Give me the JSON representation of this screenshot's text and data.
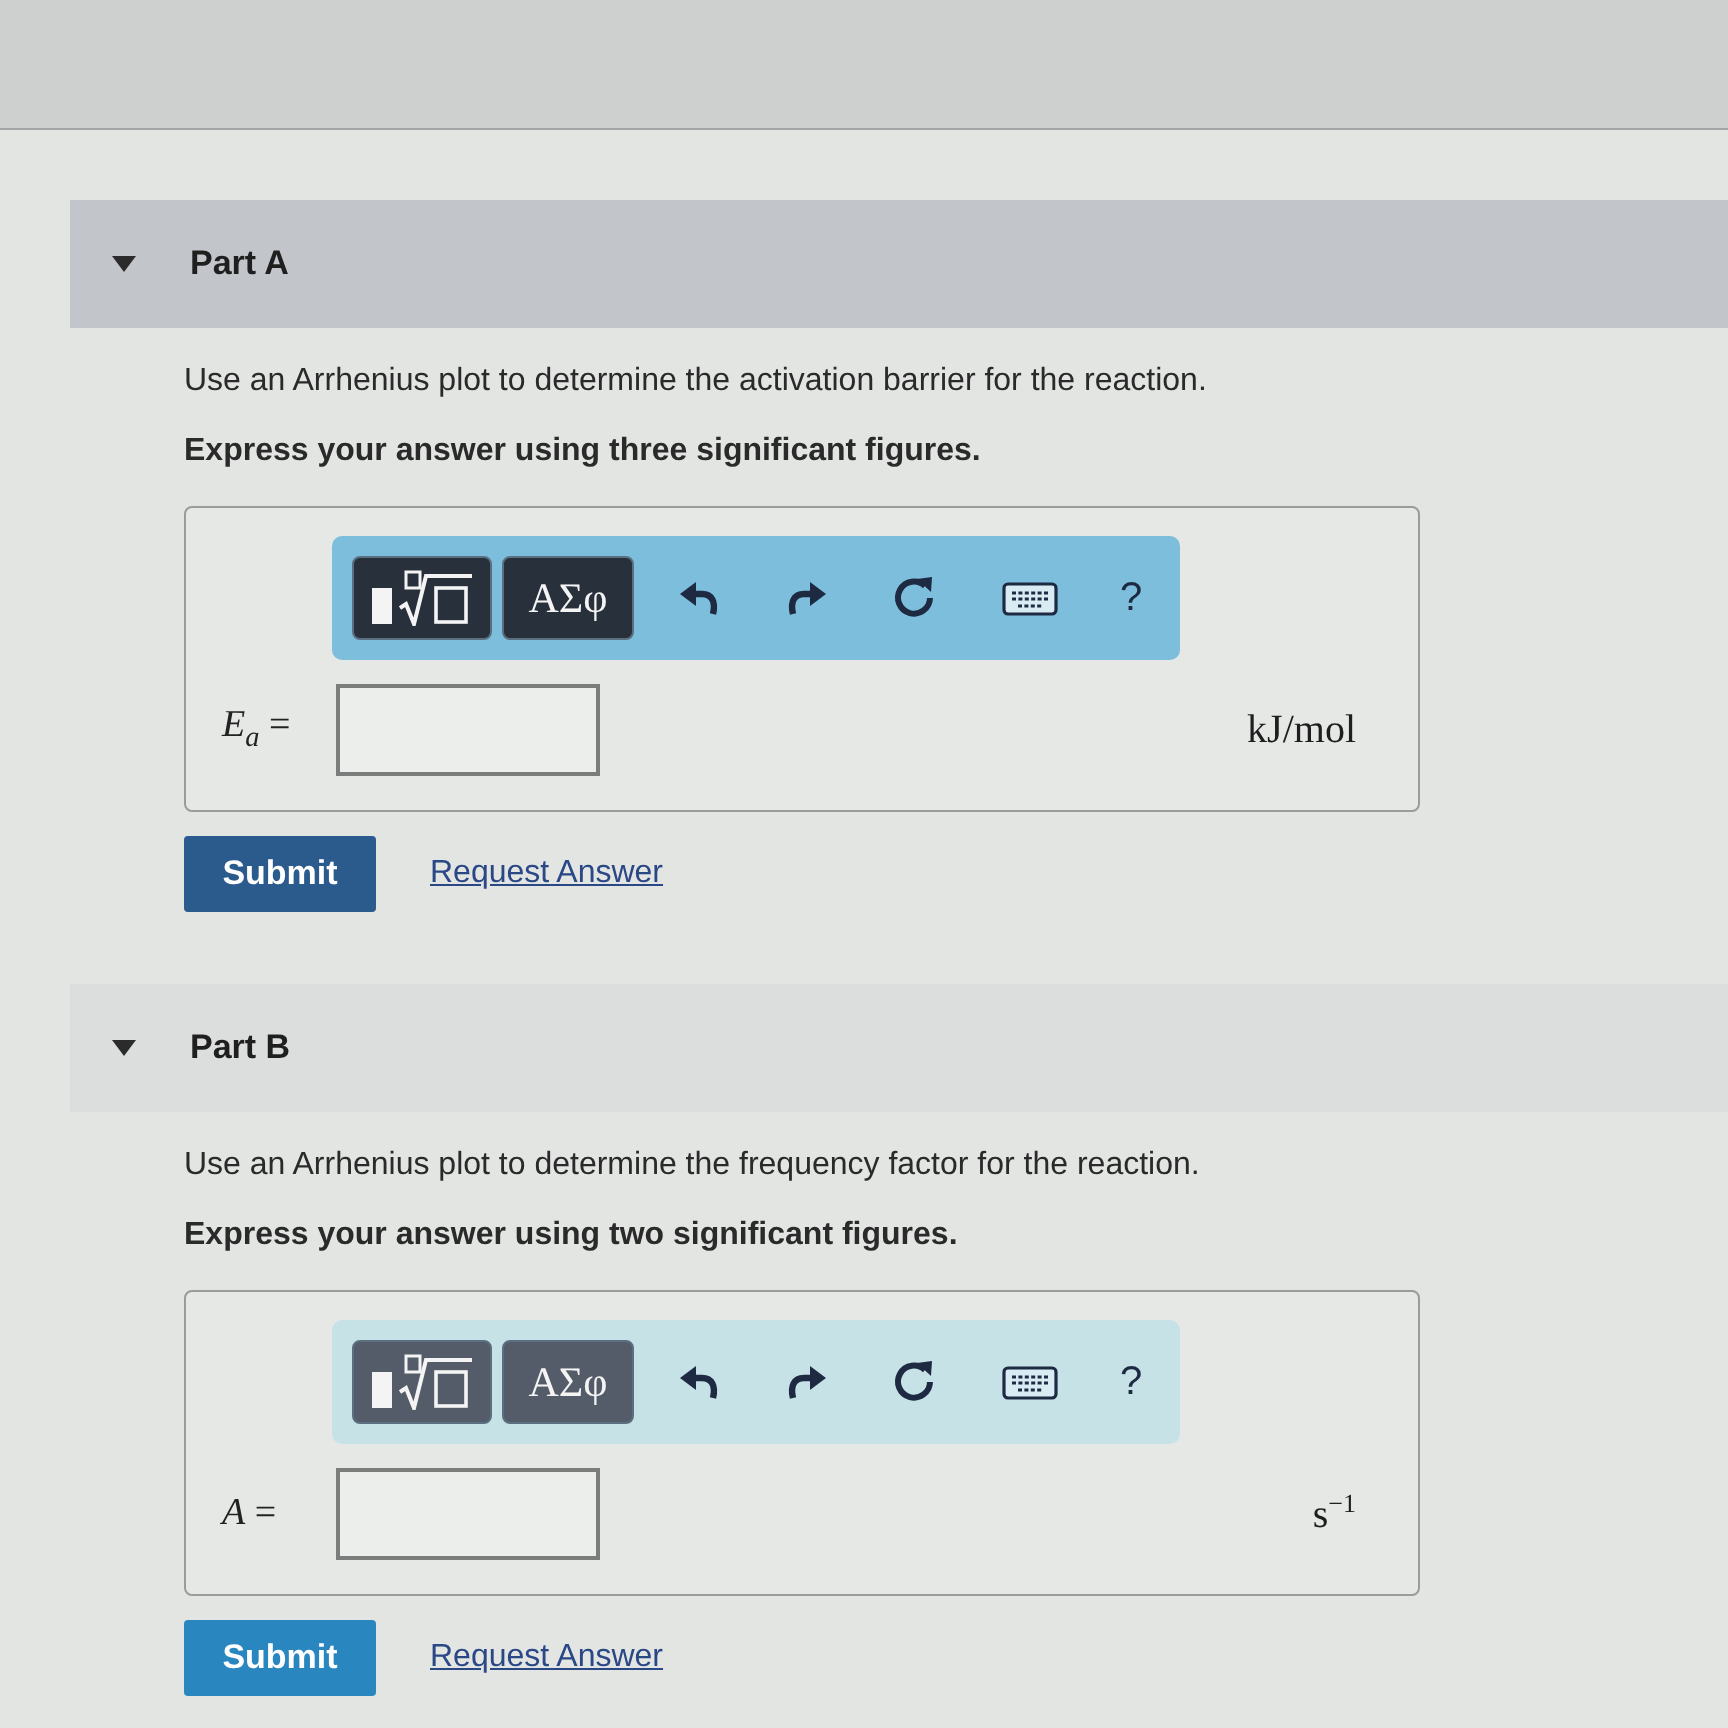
{
  "parts": [
    {
      "title": "Part A",
      "expanded": true,
      "active": true,
      "prompt": "Use an Arrhenius plot to determine the activation barrier for the reaction.",
      "instruction": "Express your answer using three significant figures.",
      "toolbar": {
        "symbols_label": "ΑΣφ",
        "help_label": "?"
      },
      "answer": {
        "label": "*E*$_{a}$ =",
        "unit": "kJ/mol"
      },
      "submit_label": "Submit",
      "request_label": "Request Answer"
    },
    {
      "title": "Part B",
      "expanded": true,
      "active": false,
      "prompt": "Use an Arrhenius plot to determine the frequency factor for the reaction.",
      "instruction": "Express your answer using two significant figures.",
      "toolbar": {
        "symbols_label": "ΑΣφ",
        "help_label": "?"
      },
      "answer": {
        "label": "*A* =",
        "unit": "s$^{−1}$"
      },
      "submit_label": "Submit",
      "request_label": "Request Answer"
    }
  ]
}
